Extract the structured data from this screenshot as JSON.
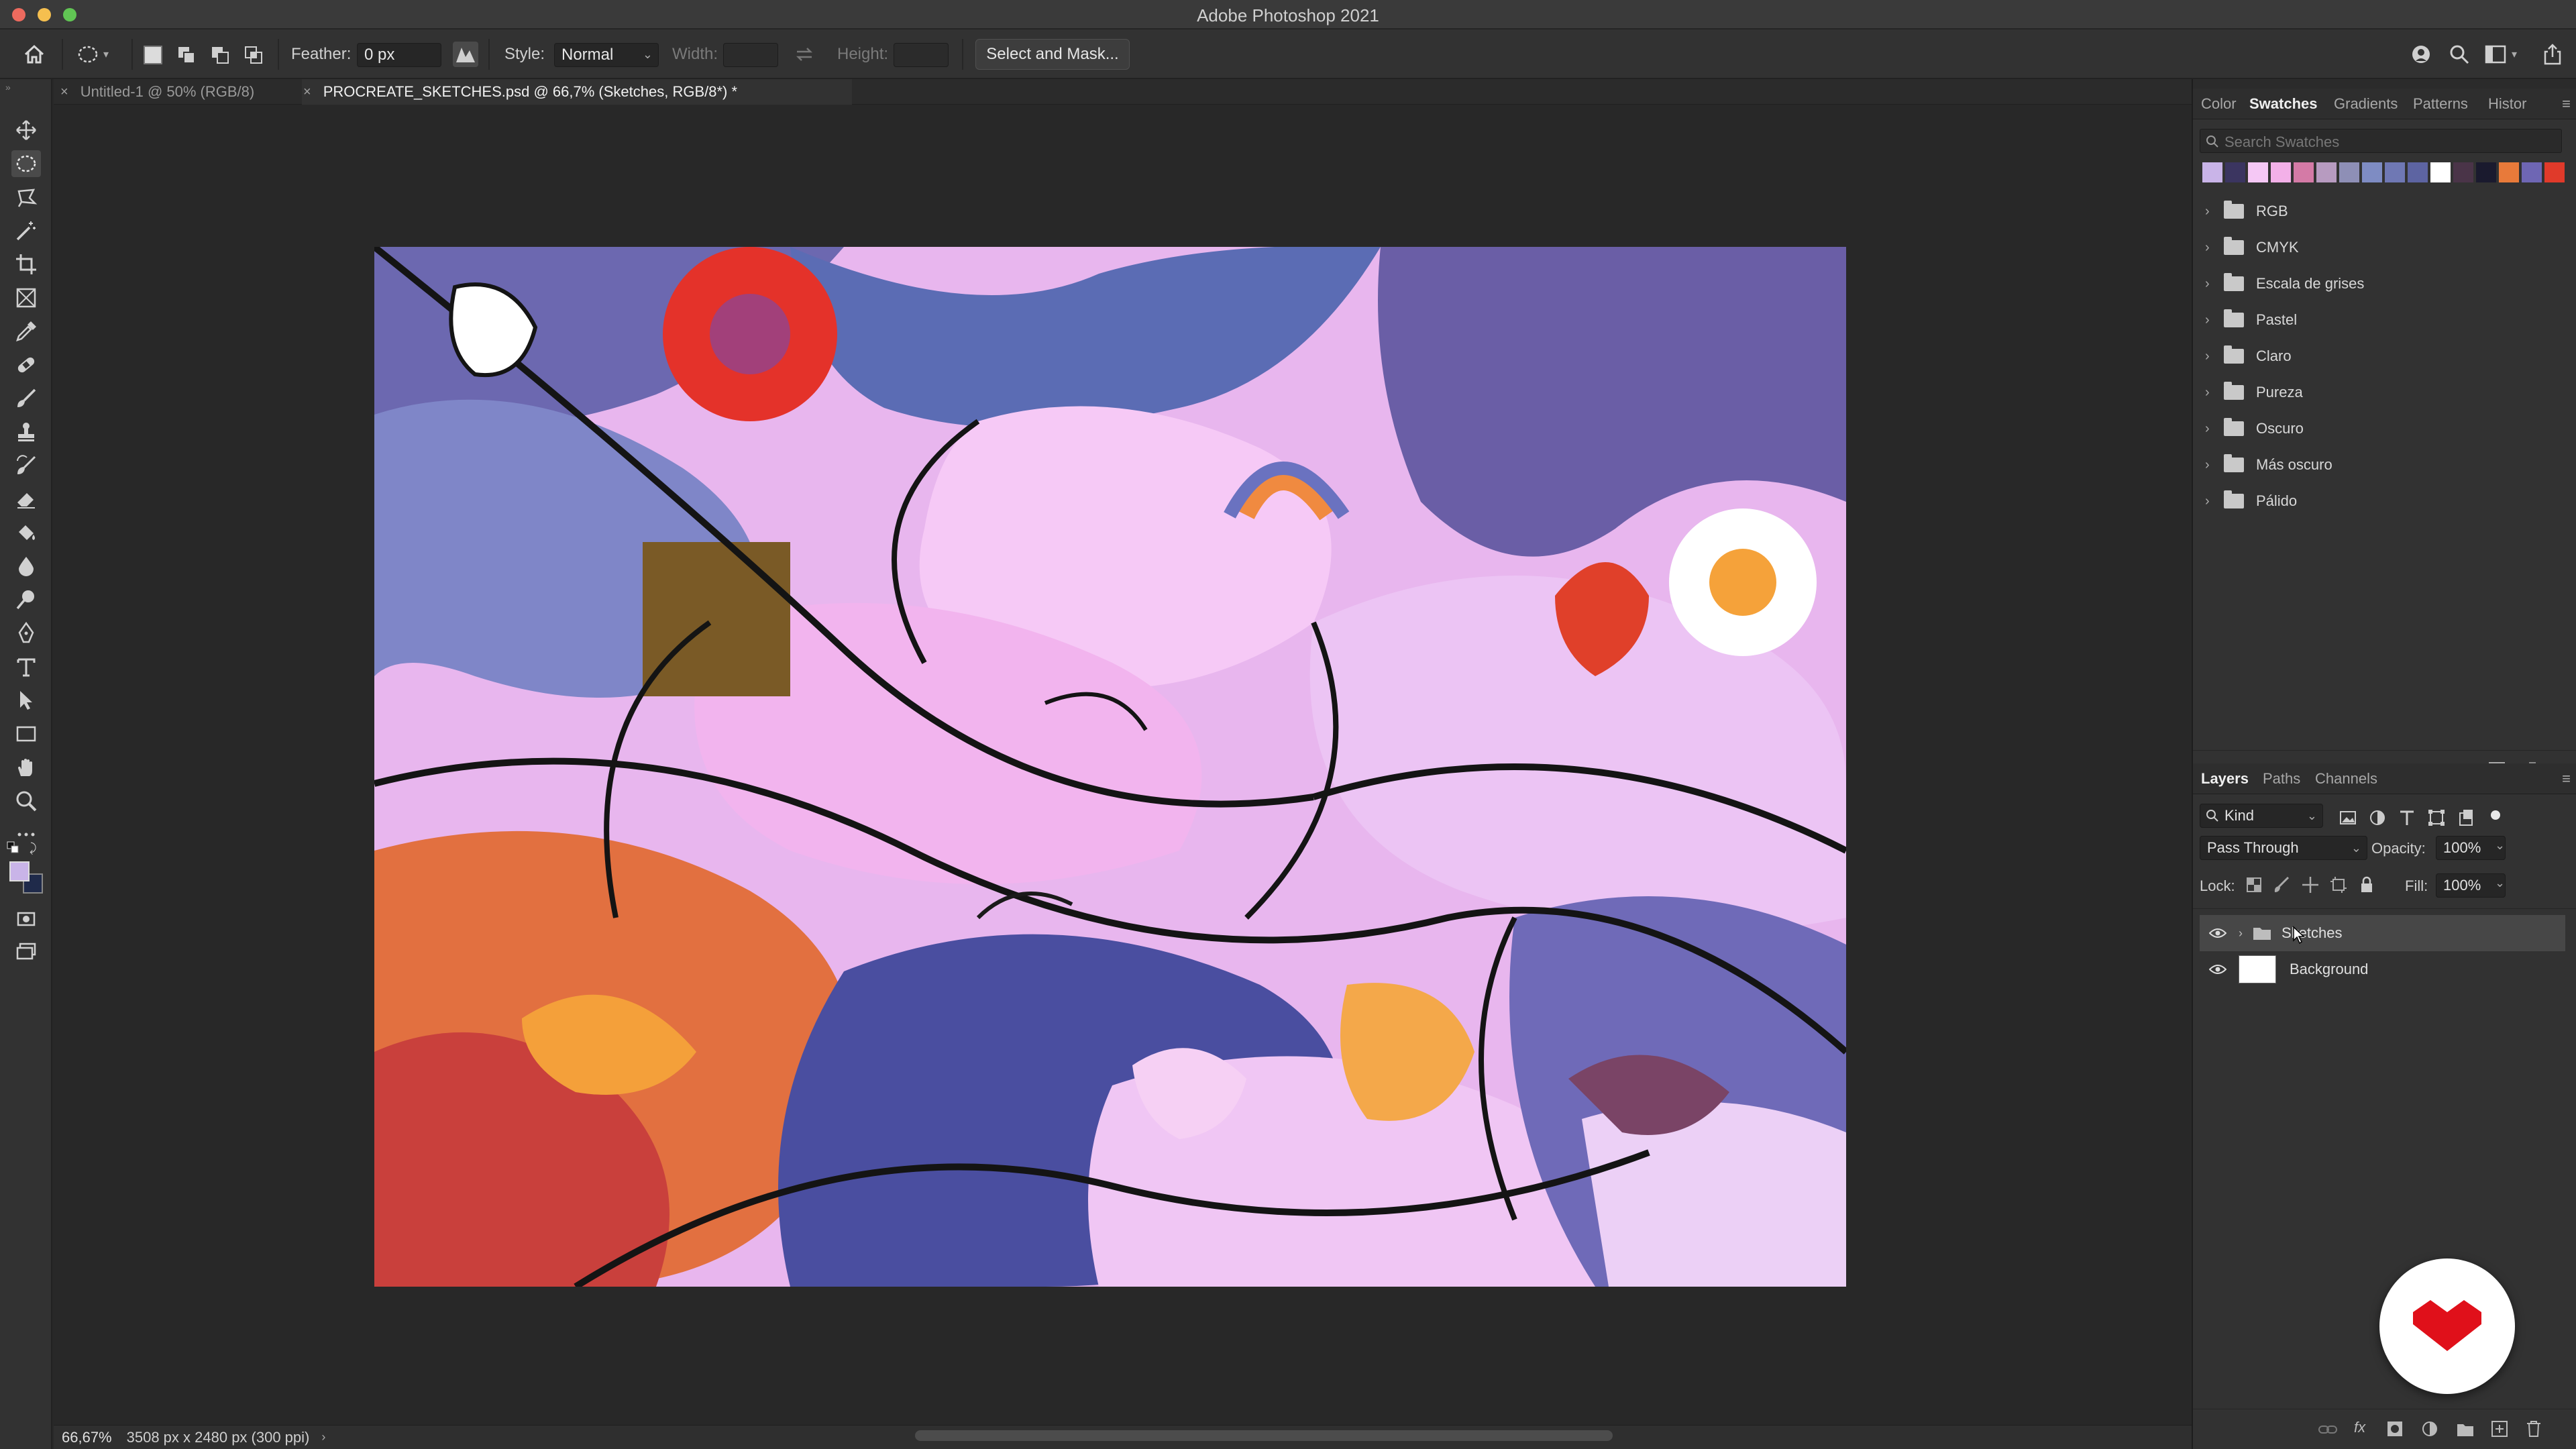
{
  "window": {
    "title": "Adobe Photoshop 2021"
  },
  "options_bar": {
    "feather_label": "Feather:",
    "feather_value": "0 px",
    "style_label": "Style:",
    "style_value": "Normal",
    "width_label": "Width:",
    "height_label": "Height:",
    "select_mask_label": "Select and Mask..."
  },
  "doc_tabs": [
    {
      "label": "Untitled-1 @ 50% (RGB/8)",
      "active": false
    },
    {
      "label": "PROCREATE_SKETCHES.psd @ 66,7% (Sketches, RGB/8*) *",
      "active": true
    }
  ],
  "status": {
    "zoom": "66,67%",
    "doc_info": "3508 px x 2480 px (300 ppi)"
  },
  "swatches_panel": {
    "tabs": [
      "Color",
      "Swatches",
      "Gradients",
      "Patterns",
      "Histor"
    ],
    "active_tab": "Swatches",
    "search_placeholder": "Search Swatches",
    "recent_colors": [
      "#c9b4e8",
      "#3b3560",
      "#f5c8f5",
      "#f3b0e8",
      "#d47aa6",
      "#b79bc0",
      "#8e8fb6",
      "#7e8cc3",
      "#6f78b4",
      "#5d64a2",
      "#ffffff",
      "#4a3448",
      "#1a1a2e",
      "#e87a3a",
      "#6e66b4",
      "#e03a2a"
    ],
    "groups": [
      "RGB",
      "CMYK",
      "Escala de grises",
      "Pastel",
      "Claro",
      "Pureza",
      "Oscuro",
      "Más oscuro",
      "Pálido"
    ]
  },
  "layers_panel": {
    "tabs": [
      "Layers",
      "Paths",
      "Channels"
    ],
    "active_tab": "Layers",
    "filter_kind": "Kind",
    "blend_mode": "Pass Through",
    "opacity_label": "Opacity:",
    "opacity_value": "100%",
    "lock_label": "Lock:",
    "fill_label": "Fill:",
    "fill_value": "100%",
    "layers": [
      {
        "name": "Sketches",
        "type": "group",
        "selected": true
      },
      {
        "name": "Background",
        "type": "pixel",
        "selected": false
      }
    ]
  },
  "colors": {
    "foreground": "#c9b4e8",
    "background": "#1f2a4a",
    "badge_red": "#e0101a"
  }
}
